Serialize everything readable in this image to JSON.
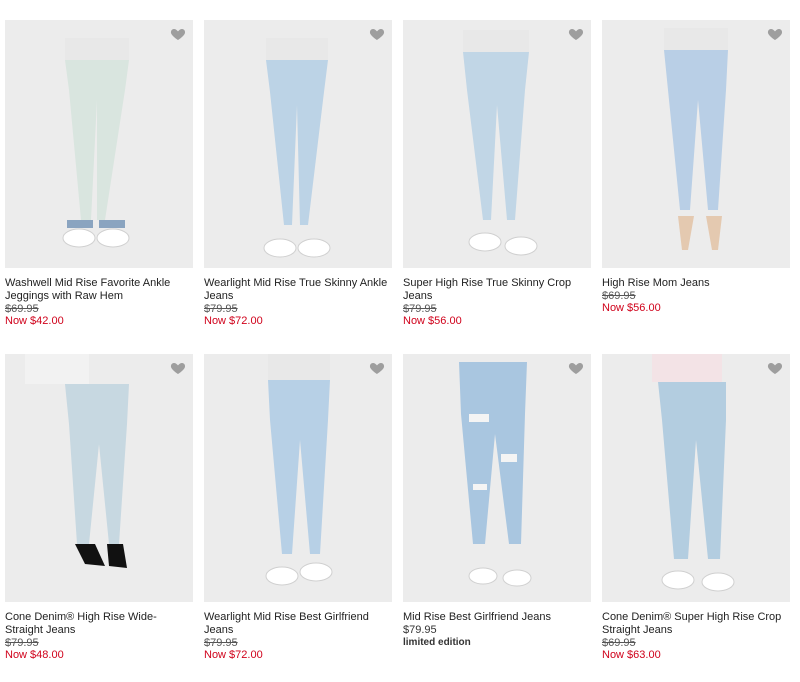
{
  "products": [
    {
      "title": "Washwell Mid Rise Favorite Ankle Jeggings with Raw Hem",
      "original_price": "$69.95",
      "sale_price": "Now $42.00",
      "denim": "#d9e5df",
      "shoe": "sneaker"
    },
    {
      "title": "Wearlight Mid Rise True Skinny Ankle Jeans",
      "original_price": "$79.95",
      "sale_price": "Now $72.00",
      "denim": "#bcd3e6",
      "shoe": "sneaker"
    },
    {
      "title": "Super High Rise True Skinny Crop Jeans",
      "original_price": "$79.95",
      "sale_price": "Now $56.00",
      "denim": "#c1d6e6",
      "shoe": "sneaker"
    },
    {
      "title": "High Rise Mom Jeans",
      "original_price": "$69.95",
      "sale_price": "Now $56.00",
      "denim": "#b9cfe6",
      "shoe": "heel-nude"
    },
    {
      "title": "Cone Denim® High Rise Wide-Straight Jeans",
      "original_price": "$79.95",
      "sale_price": "Now $48.00",
      "denim": "#c7d8e1",
      "shoe": "heel-black"
    },
    {
      "title": "Wearlight Mid Rise Best Girlfriend Jeans",
      "original_price": "$79.95",
      "sale_price": "Now $72.00",
      "denim": "#b7d0e6",
      "shoe": "sneaker"
    },
    {
      "title": "Mid Rise Best Girlfriend Jeans",
      "price": "$79.95",
      "badge": "limited edition",
      "denim": "#a9c6e0",
      "shoe": "sneaker"
    },
    {
      "title": "Cone Denim® Super High Rise Crop Straight Jeans",
      "original_price": "$69.95",
      "sale_price": "Now $63.00",
      "denim": "#b3cde0",
      "shoe": "sneaker"
    }
  ],
  "colors": {
    "sale": "#d0021b",
    "heart": "#9e9e9e",
    "photo_bg": "#ececec"
  },
  "icons": {
    "favorite": "heart-icon"
  }
}
